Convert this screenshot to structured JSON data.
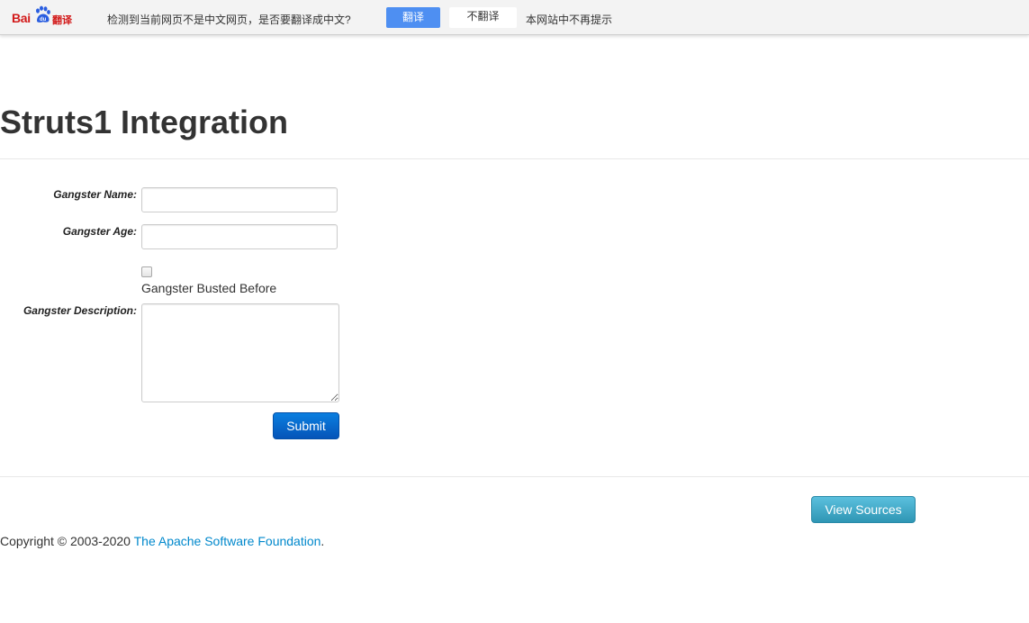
{
  "translate_bar": {
    "logo_text": "Bai",
    "logo_du": "du",
    "logo_suffix": "翻译",
    "message": "检测到当前网页不是中文网页，是否要翻译成中文?",
    "translate_button": "翻译",
    "no_translate_button": "不翻译",
    "never_link": "本网站中不再提示",
    "colors": {
      "translate_button": "#4e8ff2",
      "logo": "#d21a1a"
    }
  },
  "page": {
    "title": "Struts1 Integration"
  },
  "form": {
    "name_label": "Gangster Name:",
    "name_value": "",
    "age_label": "Gangster Age:",
    "age_value": "",
    "busted_label": "Gangster Busted Before",
    "busted_checked": false,
    "description_label": "Gangster Description:",
    "description_value": "",
    "submit_label": "Submit"
  },
  "footer": {
    "view_sources_label": "View Sources",
    "copyright_text": "Copyright © 2003-2020 ",
    "copyright_link": "The Apache Software Foundation",
    "copyright_end": "."
  }
}
